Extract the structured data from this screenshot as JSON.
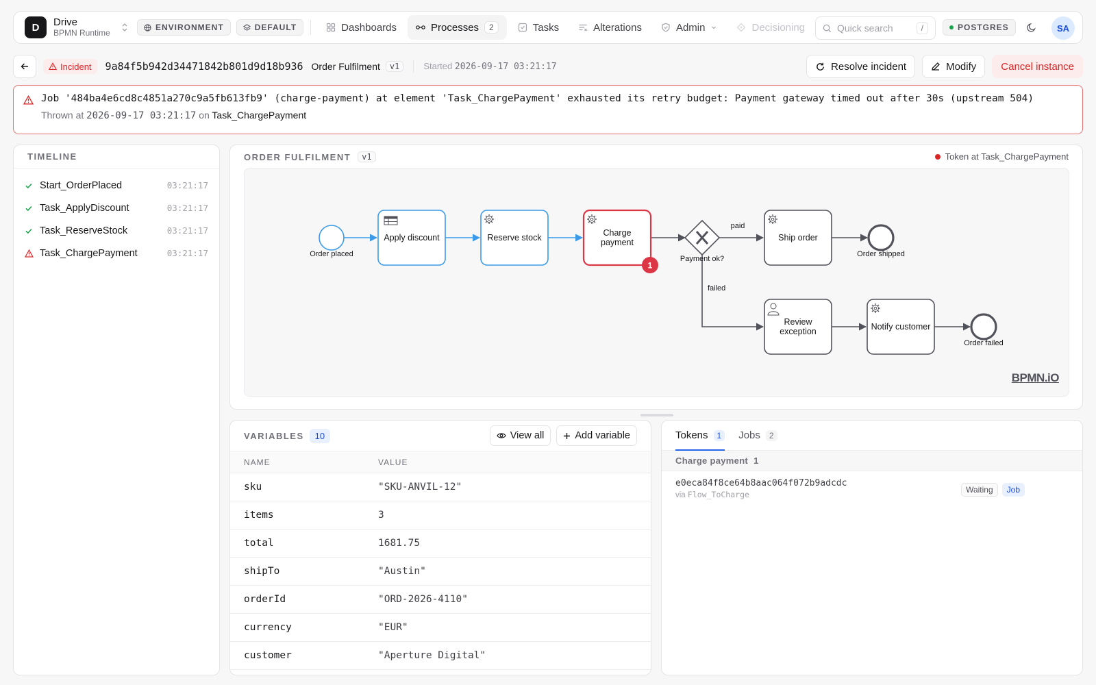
{
  "app": {
    "logo_letter": "D",
    "name": "Drive",
    "subtitle": "BPMN Runtime"
  },
  "topbar": {
    "environment_label": "ENVIRONMENT",
    "tenant_label": "DEFAULT",
    "nav": [
      {
        "label": "Dashboards",
        "icon": "grid-icon"
      },
      {
        "label": "Processes",
        "icon": "process-icon",
        "count": "2",
        "active": true
      },
      {
        "label": "Tasks",
        "icon": "task-icon"
      },
      {
        "label": "Alterations",
        "icon": "alterations-icon"
      },
      {
        "label": "Admin",
        "icon": "shield-icon",
        "has_dropdown": true
      },
      {
        "label": "Decisioning",
        "icon": "diamond-icon",
        "disabled": true
      }
    ],
    "search_placeholder": "Quick search",
    "search_shortcut": "/",
    "db_label": "POSTGRES",
    "db_status_color": "#16a34a",
    "avatar_initials": "SA"
  },
  "instance": {
    "status": "Incident",
    "id": "9a84f5b942d34471842b801d9d18b936",
    "process_name": "Order Fulfilment",
    "version": "v1",
    "started_label": "Started",
    "started_at": "2026-09-17 03:21:17",
    "actions": {
      "resolve": "Resolve incident",
      "modify": "Modify",
      "cancel": "Cancel instance"
    }
  },
  "incident": {
    "message": "Job '484ba4e6cd8c4851a270c9a5fb613fb9' (charge-payment) at element 'Task_ChargePayment' exhausted its retry budget: Payment gateway timed out after 30s (upstream 504)",
    "thrown_label": "Thrown at",
    "thrown_at": "2026-09-17 03:21:17",
    "on_label": "on",
    "element": "Task_ChargePayment"
  },
  "timeline": {
    "title": "TIMELINE",
    "items": [
      {
        "name": "Start_OrderPlaced",
        "time": "03:21:17",
        "status": "completed"
      },
      {
        "name": "Task_ApplyDiscount",
        "time": "03:21:17",
        "status": "completed"
      },
      {
        "name": "Task_ReserveStock",
        "time": "03:21:17",
        "status": "completed"
      },
      {
        "name": "Task_ChargePayment",
        "time": "03:21:17",
        "status": "incident"
      }
    ]
  },
  "diagram": {
    "title": "ORDER FULFILMENT",
    "version": "v1",
    "token_legend": "Token at Task_ChargePayment",
    "watermark": "BPMN.iO",
    "nodes": {
      "start": "Order placed",
      "apply_discount": "Apply discount",
      "reserve_stock": "Reserve stock",
      "charge_payment_1": "Charge",
      "charge_payment_2": "payment",
      "gateway": "Payment ok?",
      "ship_order": "Ship order",
      "end_shipped": "Order shipped",
      "review_1": "Review",
      "review_2": "exception",
      "notify_customer": "Notify customer",
      "end_failed": "Order failed"
    },
    "flows": {
      "paid": "paid",
      "failed": "failed"
    },
    "incident_count": "1",
    "colors": {
      "completed": "#3b9be8",
      "incident": "#dc3545",
      "pending": "#52525b"
    }
  },
  "variables": {
    "title": "VARIABLES",
    "count": "10",
    "view_all": "View all",
    "add": "Add variable",
    "col_name": "NAME",
    "col_value": "VALUE",
    "rows": [
      {
        "name": "sku",
        "value": "\"SKU-ANVIL-12\""
      },
      {
        "name": "items",
        "value": "3"
      },
      {
        "name": "total",
        "value": "1681.75"
      },
      {
        "name": "shipTo",
        "value": "\"Austin\""
      },
      {
        "name": "orderId",
        "value": "\"ORD-2026-4110\""
      },
      {
        "name": "currency",
        "value": "\"EUR\""
      },
      {
        "name": "customer",
        "value": "\"Aperture Digital\""
      }
    ]
  },
  "tokens": {
    "tabs": [
      {
        "label": "Tokens",
        "count": "1",
        "active": true
      },
      {
        "label": "Jobs",
        "count": "2"
      }
    ],
    "group": {
      "label": "Charge payment",
      "count": "1"
    },
    "items": [
      {
        "id": "e0eca84f8ce64b8aac064f072b9adcdc",
        "via_label": "via",
        "via": "Flow_ToCharge",
        "status": "Waiting",
        "kind": "Job"
      }
    ]
  }
}
